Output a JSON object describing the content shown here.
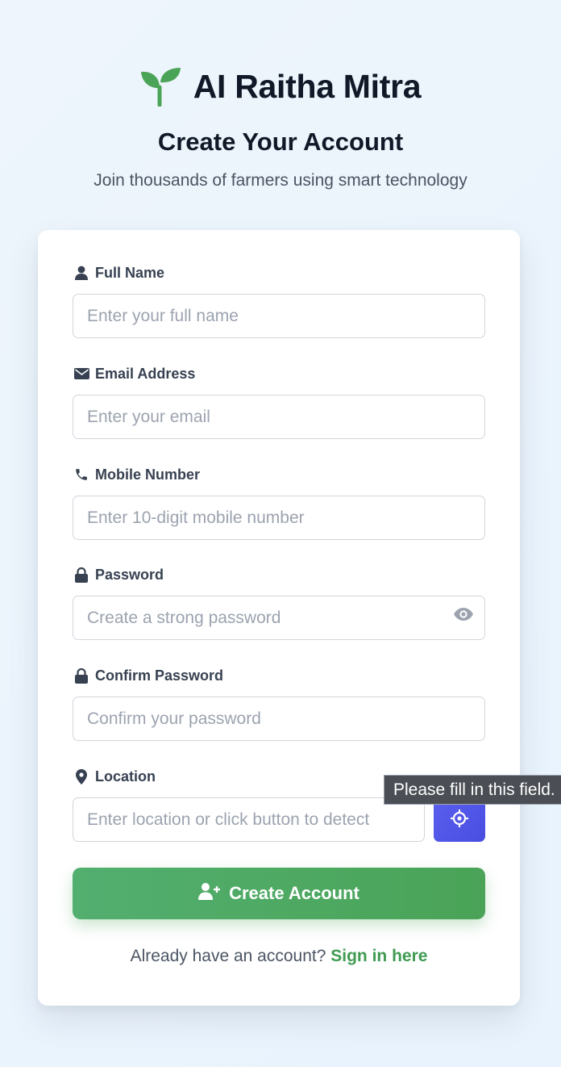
{
  "brand": {
    "title": "AI Raitha Mitra",
    "logo_icon": "seedling-icon",
    "accent_color": "#4aa357"
  },
  "header": {
    "title": "Create Your Account",
    "subtitle": "Join thousands of farmers using smart technology"
  },
  "form": {
    "full_name": {
      "label": "Full Name",
      "icon": "user-icon",
      "placeholder": "Enter your full name",
      "value": ""
    },
    "email": {
      "label": "Email Address",
      "icon": "envelope-icon",
      "placeholder": "Enter your email",
      "value": ""
    },
    "mobile": {
      "label": "Mobile Number",
      "icon": "phone-icon",
      "placeholder": "Enter 10-digit mobile number",
      "value": ""
    },
    "password": {
      "label": "Password",
      "icon": "lock-icon",
      "placeholder": "Create a strong password",
      "value": "",
      "toggle_icon": "eye-icon"
    },
    "confirm_password": {
      "label": "Confirm Password",
      "icon": "lock-icon",
      "placeholder": "Confirm your password",
      "value": ""
    },
    "location": {
      "label": "Location",
      "icon": "map-pin-icon",
      "placeholder": "Enter location or click button to detect",
      "value": "",
      "detect_icon": "crosshair-icon",
      "detect_color": "#4f52e6"
    },
    "submit_label": "Create Account",
    "submit_icon": "user-plus-icon"
  },
  "footer": {
    "prompt": "Already have an account?",
    "signin_link": "Sign in here"
  },
  "tooltip": {
    "text": "Please fill in this field."
  }
}
